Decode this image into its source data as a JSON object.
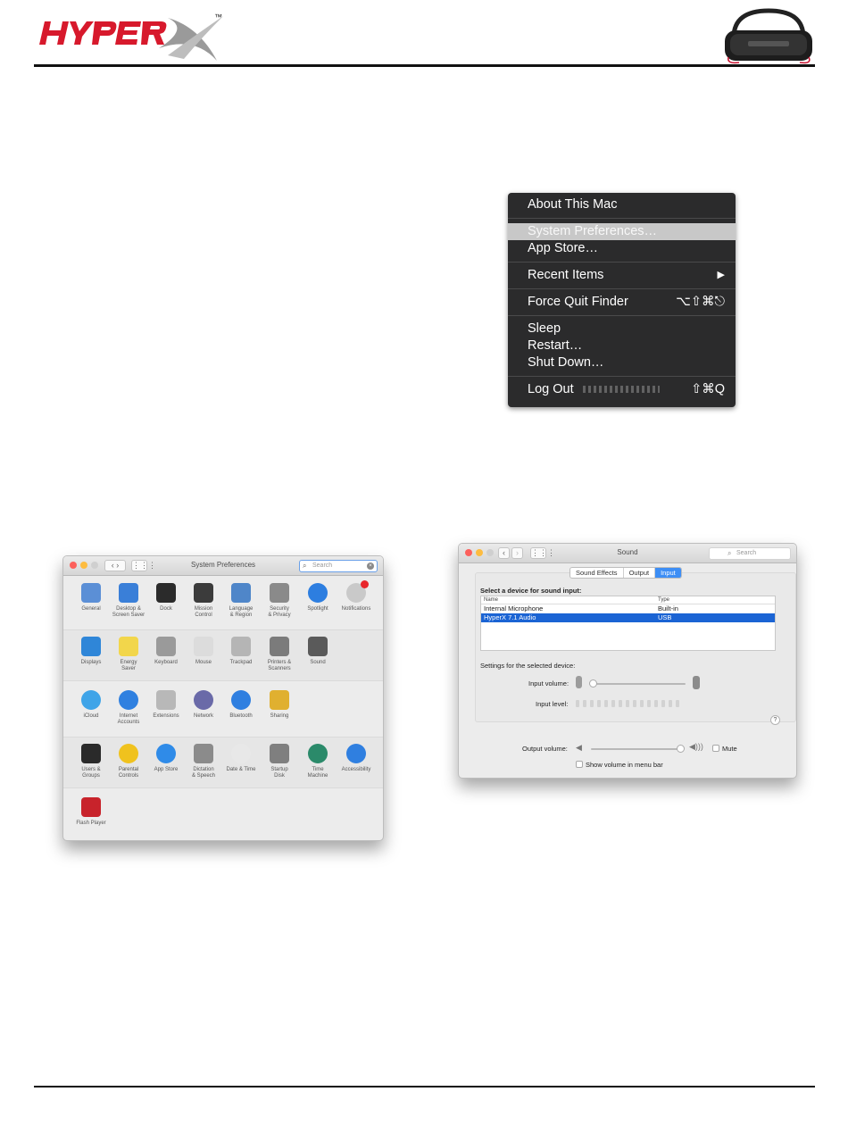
{
  "brand": {
    "logo_text": "HYPERX",
    "trademark": "™"
  },
  "apple_menu": {
    "items": [
      {
        "label": "About This Mac",
        "shortcut": ""
      },
      {
        "label": "System Preferences…",
        "shortcut": ""
      },
      {
        "label": "App Store…",
        "shortcut": ""
      },
      {
        "label": "Recent Items",
        "shortcut": "▶"
      },
      {
        "label": "Force Quit Finder",
        "shortcut": "⌥⇧⌘⎋"
      },
      {
        "label": "Sleep",
        "shortcut": ""
      },
      {
        "label": "Restart…",
        "shortcut": ""
      },
      {
        "label": "Shut Down…",
        "shortcut": ""
      },
      {
        "label": "Log Out",
        "shortcut": "⇧⌘Q"
      }
    ]
  },
  "system_preferences": {
    "title": "System Preferences",
    "search_placeholder": "Search",
    "panes": [
      {
        "label": "General",
        "icon": "general-icon",
        "color": "#5b8fd6"
      },
      {
        "label": "Desktop &\nScreen Saver",
        "icon": "desktop-icon",
        "color": "#3a7fd8"
      },
      {
        "label": "Dock",
        "icon": "dock-icon",
        "color": "#2b2b2b"
      },
      {
        "label": "Mission\nControl",
        "icon": "mission-control-icon",
        "color": "#3b3b3b"
      },
      {
        "label": "Language\n& Region",
        "icon": "globe-flag-icon",
        "color": "#4f86c9"
      },
      {
        "label": "Security\n& Privacy",
        "icon": "house-icon",
        "color": "#8a8a8a"
      },
      {
        "label": "Spotlight",
        "icon": "magnifier-icon",
        "color": "#2d7ee0"
      },
      {
        "label": "Notifications",
        "icon": "notifications-icon",
        "color": "#c9c9c9"
      },
      {
        "label": "Displays",
        "icon": "display-icon",
        "color": "#2f86d8"
      },
      {
        "label": "Energy\nSaver",
        "icon": "bulb-icon",
        "color": "#f2d64b"
      },
      {
        "label": "Keyboard",
        "icon": "keyboard-icon",
        "color": "#9a9a9a"
      },
      {
        "label": "Mouse",
        "icon": "mouse-icon",
        "color": "#dcdcdc"
      },
      {
        "label": "Trackpad",
        "icon": "trackpad-icon",
        "color": "#b5b5b5"
      },
      {
        "label": "Printers &\nScanners",
        "icon": "printer-icon",
        "color": "#7b7b7b"
      },
      {
        "label": "Sound",
        "icon": "speaker-icon",
        "color": "#5a5a5a"
      },
      {
        "label": "iCloud",
        "icon": "cloud-icon",
        "color": "#3fa4e8"
      },
      {
        "label": "Internet\nAccounts",
        "icon": "at-icon",
        "color": "#2f80e0"
      },
      {
        "label": "Extensions",
        "icon": "puzzle-icon",
        "color": "#b8b8b8"
      },
      {
        "label": "Network",
        "icon": "network-globe-icon",
        "color": "#6a6aa8"
      },
      {
        "label": "Bluetooth",
        "icon": "bluetooth-icon",
        "color": "#2f7fe0"
      },
      {
        "label": "Sharing",
        "icon": "sharing-icon",
        "color": "#e0b030"
      },
      {
        "label": "Users &\nGroups",
        "icon": "users-icon",
        "color": "#2a2a2a"
      },
      {
        "label": "Parental\nControls",
        "icon": "parental-icon",
        "color": "#f0c21e"
      },
      {
        "label": "App Store",
        "icon": "appstore-icon",
        "color": "#2f8be8"
      },
      {
        "label": "Dictation\n& Speech",
        "icon": "microphone-icon",
        "color": "#8b8b8b"
      },
      {
        "label": "Date & Time",
        "icon": "clock-icon",
        "color": "#e8e8e8"
      },
      {
        "label": "Startup\nDisk",
        "icon": "disk-icon",
        "color": "#7f7f7f"
      },
      {
        "label": "Time\nMachine",
        "icon": "time-machine-icon",
        "color": "#2b8a6a"
      },
      {
        "label": "Accessibility",
        "icon": "accessibility-icon",
        "color": "#2f7fe0"
      },
      {
        "label": "Flash Player",
        "icon": "flash-icon",
        "color": "#c8232b"
      }
    ]
  },
  "sound": {
    "title": "Sound",
    "search_placeholder": "Search",
    "tabs": [
      "Sound Effects",
      "Output",
      "Input"
    ],
    "active_tab": "Input",
    "select_label": "Select a device for sound input:",
    "columns": [
      "Name",
      "Type"
    ],
    "devices": [
      {
        "name": "Internal Microphone",
        "type": "Built-in",
        "selected": false
      },
      {
        "name": "HyperX 7.1 Audio",
        "type": "USB",
        "selected": true
      }
    ],
    "settings_label": "Settings for the selected device:",
    "input_volume_label": "Input volume:",
    "input_level_label": "Input level:",
    "help": "?",
    "output_volume_label": "Output volume:",
    "mute_label": "Mute",
    "menu_bar_label": "Show volume in menu bar"
  }
}
